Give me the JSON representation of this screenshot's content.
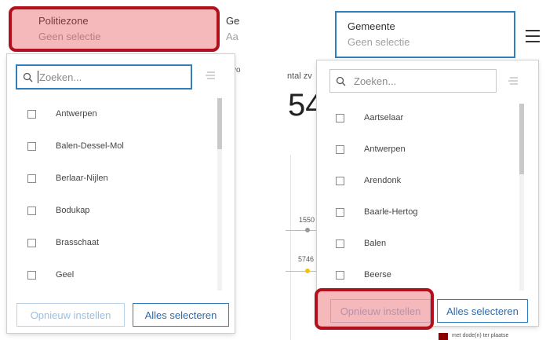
{
  "left_panel": {
    "header": {
      "title": "Politiezone",
      "subtitle": "Geen selectie",
      "next_title_partial": "Ge",
      "next_subtitle_partial": "Aa",
      "next_partial_row3": "vo"
    },
    "search": {
      "placeholder": "Zoeken...",
      "value": ""
    },
    "items": [
      {
        "label": "Antwerpen",
        "checked": false
      },
      {
        "label": "Balen-Dessel-Mol",
        "checked": false
      },
      {
        "label": "Berlaar-Nijlen",
        "checked": false
      },
      {
        "label": "Bodukap",
        "checked": false
      },
      {
        "label": "Brasschaat",
        "checked": false
      },
      {
        "label": "Geel",
        "checked": false
      }
    ],
    "reset_label": "Opnieuw instellen",
    "select_all_label": "Alles selecteren"
  },
  "right_panel": {
    "header": {
      "title": "Gemeente",
      "subtitle": "Geen selectie"
    },
    "bg": {
      "partial_label": "ntal zv",
      "big_number": "54",
      "value_a": "1550",
      "value_b": "5746",
      "legend_partial": "met dode(n) ter plaatse"
    },
    "search": {
      "placeholder": "Zoeken...",
      "value": ""
    },
    "items": [
      {
        "label": "Aartselaar",
        "checked": false
      },
      {
        "label": "Antwerpen",
        "checked": false
      },
      {
        "label": "Arendonk",
        "checked": false
      },
      {
        "label": "Baarle-Hertog",
        "checked": false
      },
      {
        "label": "Balen",
        "checked": false
      },
      {
        "label": "Beerse",
        "checked": false
      }
    ],
    "reset_label": "Opnieuw instellen",
    "select_all_label": "Alles selecteren"
  },
  "icons": {
    "search": "search-icon",
    "filter": "filter-list-icon",
    "menu": "hamburger-menu-icon"
  },
  "colors": {
    "accent": "#2f7fbf",
    "highlight_border": "#b3101e",
    "highlight_fill": "#e44650",
    "chart_yellow": "#f2c500",
    "legend_dark_red": "#8b0000"
  }
}
